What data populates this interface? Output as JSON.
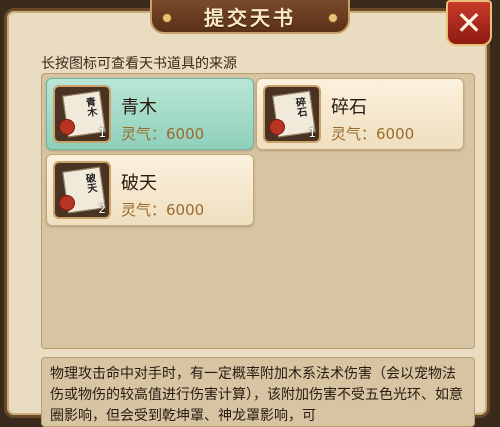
{
  "dialog": {
    "title": "提交天书",
    "close_label": "✕",
    "hint": "长按图标可查看天书道具的来源"
  },
  "items": [
    {
      "name": "青木",
      "value": "灵气：6000",
      "count": "1",
      "glyph": "青木",
      "selected": true
    },
    {
      "name": "碎石",
      "value": "灵气：6000",
      "count": "1",
      "glyph": "碎石",
      "selected": false
    },
    {
      "name": "破天",
      "value": "灵气：6000",
      "count": "2",
      "glyph": "破天",
      "selected": false
    }
  ],
  "description": "物理攻击命中对手时，有一定概率附加木系法术伤害（会以宠物法伤或物伤的较高值进行伤害计算），该附加伤害不受五色光环、如意圈影响，但会受到乾坤罩、神龙罩影响，可",
  "colors": {
    "selected_card": "#8fd0bb",
    "value_text": "#9a6a2a",
    "close_button": "#c83a2a"
  }
}
